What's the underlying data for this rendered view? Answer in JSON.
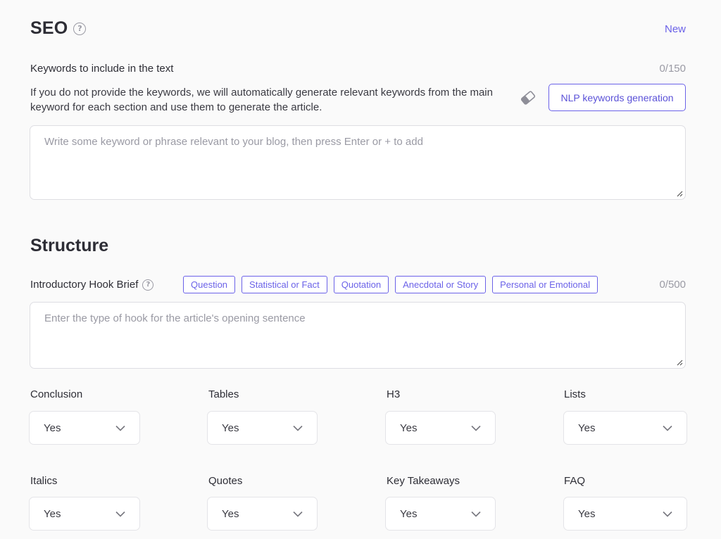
{
  "seo": {
    "title": "SEO",
    "new_link": "New",
    "keywords_label": "Keywords to include in the text",
    "keywords_count": "0/150",
    "keywords_description": "If you do not provide the keywords, we will automatically generate relevant keywords from the main keyword for each section and use them to generate the article.",
    "nlp_button": "NLP keywords generation",
    "keywords_placeholder": "Write some keyword or phrase relevant to your blog, then press Enter or + to add"
  },
  "structure": {
    "title": "Structure",
    "hook_label": "Introductory Hook Brief",
    "hook_count": "0/500",
    "hook_chips": [
      "Question",
      "Statistical or Fact",
      "Quotation",
      "Anecdotal or Story",
      "Personal or Emotional"
    ],
    "hook_placeholder": "Enter the type of hook for the article's opening sentence",
    "options": [
      {
        "label": "Conclusion",
        "value": "Yes"
      },
      {
        "label": "Tables",
        "value": "Yes"
      },
      {
        "label": "H3",
        "value": "Yes"
      },
      {
        "label": "Lists",
        "value": "Yes"
      },
      {
        "label": "Italics",
        "value": "Yes"
      },
      {
        "label": "Quotes",
        "value": "Yes"
      },
      {
        "label": "Key Takeaways",
        "value": "Yes"
      },
      {
        "label": "FAQ",
        "value": "Yes"
      }
    ]
  },
  "icons": {
    "help": "help-icon",
    "eraser": "eraser-icon",
    "chevron": "chevron-down-icon",
    "resize": "resize-grip-icon"
  },
  "colors": {
    "accent": "#6b62e8",
    "muted": "#9a9aa4",
    "text": "#2d2d35"
  }
}
